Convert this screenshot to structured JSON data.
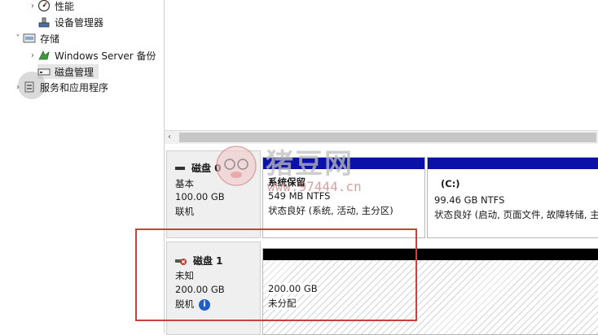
{
  "tree": {
    "items": [
      {
        "label": "性能",
        "arrow": "›",
        "icon": "performance-icon"
      },
      {
        "label": "设备管理器",
        "arrow": "",
        "icon": "device-manager-icon"
      },
      {
        "label": "存储",
        "arrow": "˅",
        "icon": "storage-icon"
      },
      {
        "label": "Windows Server 备份",
        "arrow": "›",
        "icon": "windows-server-backup-icon"
      },
      {
        "label": "磁盘管理",
        "arrow": "",
        "icon": "disk-management-icon"
      },
      {
        "label": "服务和应用程序",
        "arrow": "›",
        "icon": "services-applications-icon"
      }
    ]
  },
  "scrollbar": {
    "left_arrow": "‹"
  },
  "disks": [
    {
      "name": "磁盘 0",
      "type": "基本",
      "size": "100.00 GB",
      "status": "联机",
      "partitions": [
        {
          "name": "系统保留",
          "size_fs": "549 MB NTFS",
          "health": "状态良好 (系统, 活动, 主分区)",
          "color": "#0a10a8"
        },
        {
          "name": "(C:)",
          "size_fs": "99.46 GB NTFS",
          "health": "状态良好 (启动, 页面文件, 故障转储, 主",
          "color": "#0a10a8"
        }
      ]
    },
    {
      "name": "磁盘 1",
      "type": "未知",
      "size": "200.00 GB",
      "status": "脱机",
      "info_glyph": "i",
      "partitions": [
        {
          "size_fs": "200.00 GB",
          "health": "未分配",
          "color": "#000000"
        }
      ]
    }
  ],
  "watermark": {
    "text": "猪豆网",
    "url": "www.97444.cn"
  },
  "colors": {
    "highlight": "#c9413a",
    "primary_partition": "#0a10a8",
    "unallocated": "#000000"
  }
}
